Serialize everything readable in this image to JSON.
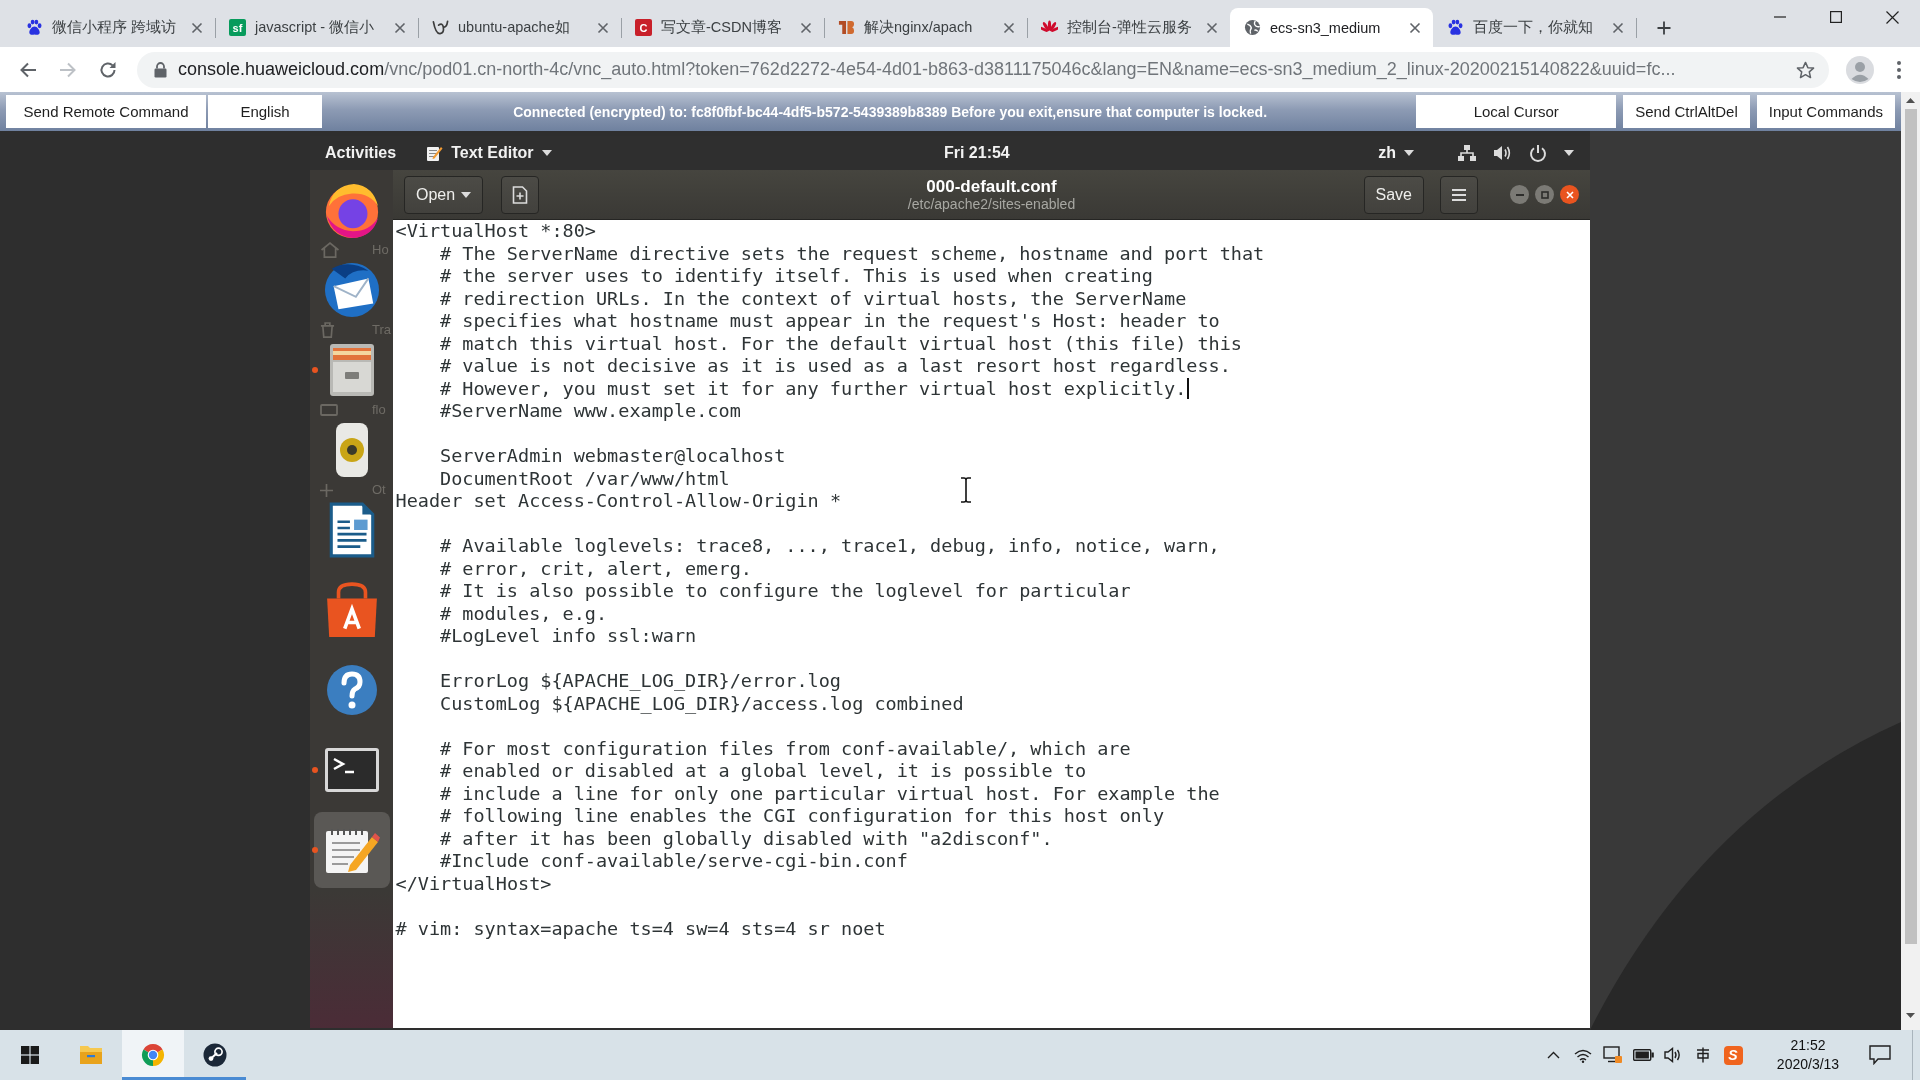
{
  "browser": {
    "tabs": [
      {
        "kind": "paw",
        "title": "微信小程序 跨域访",
        "selected": false
      },
      {
        "kind": "letters",
        "icon_text": "sf",
        "color": "#079b5c",
        "title": "javascript - 微信小",
        "selected": false
      },
      {
        "kind": "swirl",
        "title": "ubuntu-apache如",
        "selected": false
      },
      {
        "kind": "letters",
        "icon_text": "C",
        "color": "#c8202a",
        "title": "写文章-CSDN博客",
        "selected": false
      },
      {
        "kind": "mark",
        "title": "解决nginx/apach",
        "selected": false
      },
      {
        "kind": "petals",
        "title": "控制台-弹性云服务",
        "selected": false
      },
      {
        "kind": "globe",
        "title": "ecs-sn3_medium",
        "selected": true
      },
      {
        "kind": "paw",
        "title": "百度一下，你就知",
        "selected": false
      }
    ],
    "nav_buttons": [
      {
        "kind": "back",
        "disabled": false
      },
      {
        "kind": "forward",
        "disabled": true
      },
      {
        "kind": "reload",
        "disabled": false
      }
    ],
    "address_bar": {
      "host": "console.huaweicloud.com",
      "path": "/vnc/pod01.cn-north-4c/vnc_auto.html?token=762d2272-4e54-4d01-b863-d3811175046c&lang=EN&name=ecs-sn3_medium_2_linux-20200215140822&uuid=fc..."
    }
  },
  "vnc_toolbar": {
    "left_buttons": [
      "Send Remote Command",
      "English"
    ],
    "status": "Connected (encrypted) to: fc8f0fbf-bc44-4df5-b572-5439389b8389 Before you exit,ensure that computer is locked.",
    "right_buttons": [
      "Local Cursor",
      "Send CtrlAltDel",
      "Input Commands"
    ]
  },
  "ubuntu": {
    "top_bar": {
      "activities": "Activities",
      "app_menu": "Text Editor",
      "clock": "Fri 21:54",
      "input_source": "zh"
    },
    "desktop_items": [
      {
        "kind": "home",
        "label": "Ho"
      },
      {
        "kind": "trash",
        "label": "Tra"
      },
      {
        "kind": "drive",
        "label": "flo"
      },
      {
        "kind": "plus",
        "label": "Ot"
      }
    ],
    "dock": [
      {
        "kind": "fox",
        "selected": false,
        "running": false
      },
      {
        "kind": "bird-mail",
        "selected": false,
        "running": false
      },
      {
        "kind": "cabinet",
        "selected": false,
        "running": true
      },
      {
        "kind": "speaker",
        "selected": false,
        "running": false
      },
      {
        "kind": "document",
        "selected": false,
        "running": false
      },
      {
        "kind": "bag",
        "selected": false,
        "running": false
      },
      {
        "kind": "help",
        "selected": false,
        "running": false
      },
      {
        "kind": "terminal",
        "selected": false,
        "running": true
      },
      {
        "kind": "notepad",
        "selected": true,
        "running": true
      }
    ],
    "editor": {
      "open_button": "Open",
      "title": "000-default.conf",
      "subtitle": "/etc/apache2/sites-enabled",
      "save_button": "Save",
      "lines": [
        {
          "kind": "code",
          "text": "<VirtualHost *:80>",
          "caret": false,
          "children": [
            {
              "kind": "code",
              "text": "# The ServerName directive sets the request scheme, hostname and port that",
              "caret": false
            },
            {
              "kind": "code",
              "text": "# the server uses to identify itself. This is used when creating",
              "caret": false
            },
            {
              "kind": "code",
              "text": "# redirection URLs. In the context of virtual hosts, the ServerName",
              "caret": false
            },
            {
              "kind": "code",
              "text": "# specifies what hostname must appear in the request's Host: header to",
              "caret": false
            },
            {
              "kind": "code",
              "text": "# match this virtual host. For the default virtual host (this file) this",
              "caret": false
            },
            {
              "kind": "code",
              "text": "# value is not decisive as it is used as a last resort host regardless.",
              "caret": false
            },
            {
              "kind": "code",
              "text": "# However, you must set it for any further virtual host explicitly.",
              "caret": true
            },
            {
              "kind": "code",
              "text": "#ServerName www.example.com",
              "caret": false
            },
            {
              "kind": "blank"
            },
            {
              "kind": "code",
              "text": "ServerAdmin webmaster@localhost",
              "caret": false
            },
            {
              "kind": "code",
              "text": "DocumentRoot /var/www/html",
              "caret": false
            }
          ]
        },
        {
          "kind": "code",
          "text": "Header set Access-Control-Allow-Origin *",
          "caret": false,
          "children": [
            {
              "kind": "blank"
            },
            {
              "kind": "code",
              "text": "# Available loglevels: trace8, ..., trace1, debug, info, notice, warn,",
              "caret": false
            },
            {
              "kind": "code",
              "text": "# error, crit, alert, emerg.",
              "caret": false
            },
            {
              "kind": "code",
              "text": "# It is also possible to configure the loglevel for particular",
              "caret": false
            },
            {
              "kind": "code",
              "text": "# modules, e.g.",
              "caret": false
            },
            {
              "kind": "code",
              "text": "#LogLevel info ssl:warn",
              "caret": false
            },
            {
              "kind": "blank"
            },
            {
              "kind": "code",
              "text": "ErrorLog ${APACHE_LOG_DIR}/error.log",
              "caret": false
            },
            {
              "kind": "code",
              "text": "CustomLog ${APACHE_LOG_DIR}/access.log combined",
              "caret": false
            },
            {
              "kind": "blank"
            },
            {
              "kind": "code",
              "text": "# For most configuration files from conf-available/, which are",
              "caret": false
            },
            {
              "kind": "code",
              "text": "# enabled or disabled at a global level, it is possible to",
              "caret": false
            },
            {
              "kind": "code",
              "text": "# include a line for only one particular virtual host. For example the",
              "caret": false
            },
            {
              "kind": "code",
              "text": "# following line enables the CGI configuration for this host only",
              "caret": false
            },
            {
              "kind": "code",
              "text": "# after it has been globally disabled with \"a2disconf\".",
              "caret": false
            },
            {
              "kind": "code",
              "text": "#Include conf-available/serve-cgi-bin.conf",
              "caret": false
            }
          ]
        },
        {
          "kind": "code",
          "text": "</VirtualHost>",
          "caret": false
        },
        {
          "kind": "blank"
        },
        {
          "kind": "code",
          "text": "# vim: syntax=apache ts=4 sw=4 sts=4 sr noet",
          "caret": false
        }
      ]
    }
  },
  "taskbar": {
    "apps": [
      {
        "kind": "folder",
        "selected": false,
        "running": false
      },
      {
        "kind": "tricolor",
        "selected": true,
        "running": true
      },
      {
        "kind": "piston",
        "selected": false,
        "running": true
      }
    ],
    "tray": [
      {
        "kind": "chevron"
      },
      {
        "kind": "wifi"
      },
      {
        "kind": "display"
      },
      {
        "kind": "battery"
      },
      {
        "kind": "volume"
      },
      {
        "kind": "input-method"
      },
      {
        "kind": "letter",
        "text": "S"
      }
    ],
    "clock": {
      "time": "21:52",
      "date": "2020/3/13"
    }
  }
}
